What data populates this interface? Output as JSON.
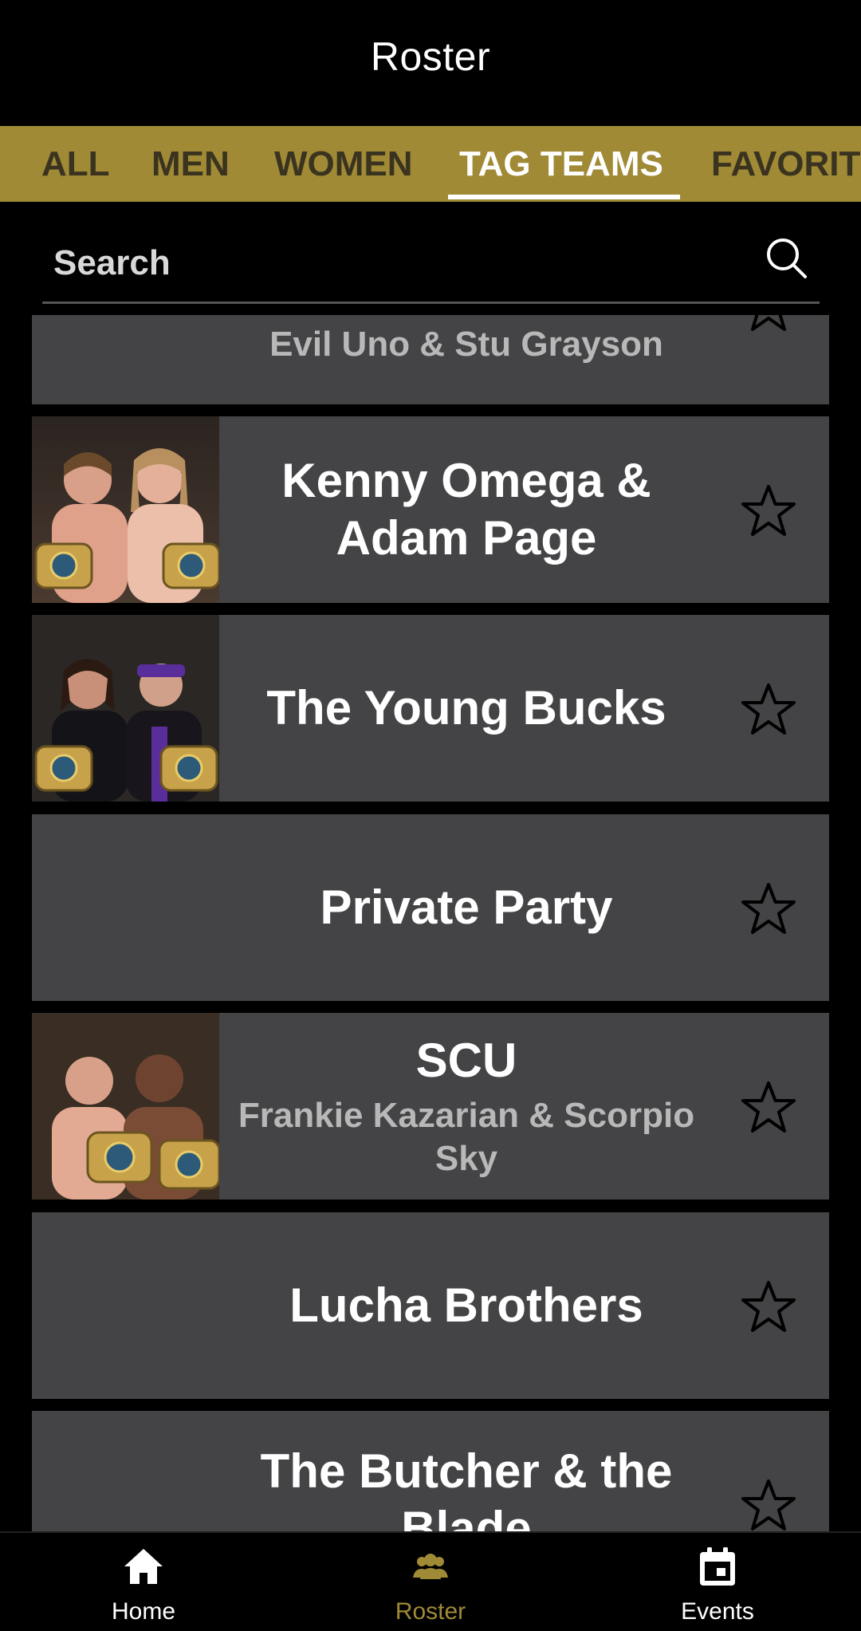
{
  "header": {
    "title": "Roster"
  },
  "tabs": [
    {
      "label": "ALL",
      "active": false
    },
    {
      "label": "MEN",
      "active": false
    },
    {
      "label": "WOMEN",
      "active": false
    },
    {
      "label": "TAG TEAMS",
      "active": true
    },
    {
      "label": "FAVORIT",
      "active": false
    }
  ],
  "search": {
    "placeholder": "Search",
    "value": ""
  },
  "teams": [
    {
      "name": "",
      "members": "Evil Uno & Stu Grayson",
      "has_photo": false
    },
    {
      "name": "Kenny Omega & Adam Page",
      "members": "",
      "has_photo": true
    },
    {
      "name": "The Young Bucks",
      "members": "",
      "has_photo": true
    },
    {
      "name": "Private Party",
      "members": "",
      "has_photo": false
    },
    {
      "name": "SCU",
      "members": "Frankie Kazarian & Scorpio Sky",
      "has_photo": true
    },
    {
      "name": "Lucha Brothers",
      "members": "",
      "has_photo": false
    },
    {
      "name": "The Butcher & the Blade",
      "members": "",
      "has_photo": false
    }
  ],
  "bottom_nav": [
    {
      "label": "Home",
      "icon": "home-icon",
      "active": false
    },
    {
      "label": "Roster",
      "icon": "group-icon",
      "active": true
    },
    {
      "label": "Events",
      "icon": "calendar-icon",
      "active": false
    }
  ],
  "colors": {
    "accent": "#a08a35",
    "card_bg": "#444345",
    "background": "#000000"
  }
}
